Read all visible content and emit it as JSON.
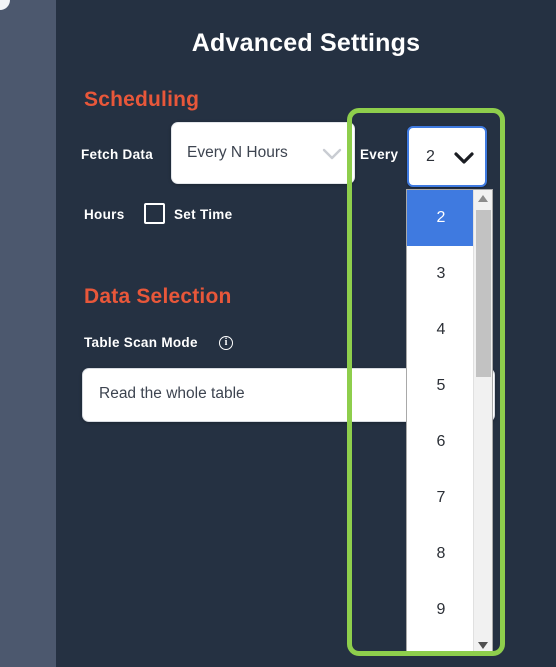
{
  "window": {
    "panel_bg": "#253142",
    "rail_bg": "#4c586e"
  },
  "header": {
    "title": "Advanced Settings"
  },
  "sections": {
    "scheduling": {
      "heading": "Scheduling",
      "heading_color": "#e8573a",
      "fetch_data": {
        "label": "Fetch Data",
        "value": "Every N Hours",
        "chevron": "chevron-down-icon"
      },
      "every": {
        "label": "Every",
        "value": "2",
        "chevron": "chevron-down-icon",
        "focused": true,
        "focus_color": "#3f7ae0"
      },
      "interval_unit": {
        "label": "Hours"
      },
      "set_time": {
        "label": "Set Time",
        "checked": false
      }
    },
    "data_selection": {
      "heading": "Data Selection",
      "heading_color": "#e8573a",
      "table_scan_mode": {
        "label": "Table Scan Mode",
        "info_icon": "info-icon",
        "info_glyph": "i",
        "value": "Read the whole table",
        "chevron": "chevron-down-icon"
      }
    }
  },
  "dropdown": {
    "open": true,
    "selected_value": "2",
    "options": [
      "2",
      "3",
      "4",
      "5",
      "6",
      "7",
      "8",
      "9"
    ],
    "highlight_color": "#3f7ae0",
    "scrollbar": {
      "up_arrow": "scroll-up-arrow-icon",
      "down_arrow": "scroll-down-arrow-icon",
      "thumb_color": "#c2c2c2",
      "track_color": "#f1f1f1"
    }
  },
  "annotation": {
    "highlight_color": "#8ece4c",
    "shape": "rounded-rectangle"
  }
}
